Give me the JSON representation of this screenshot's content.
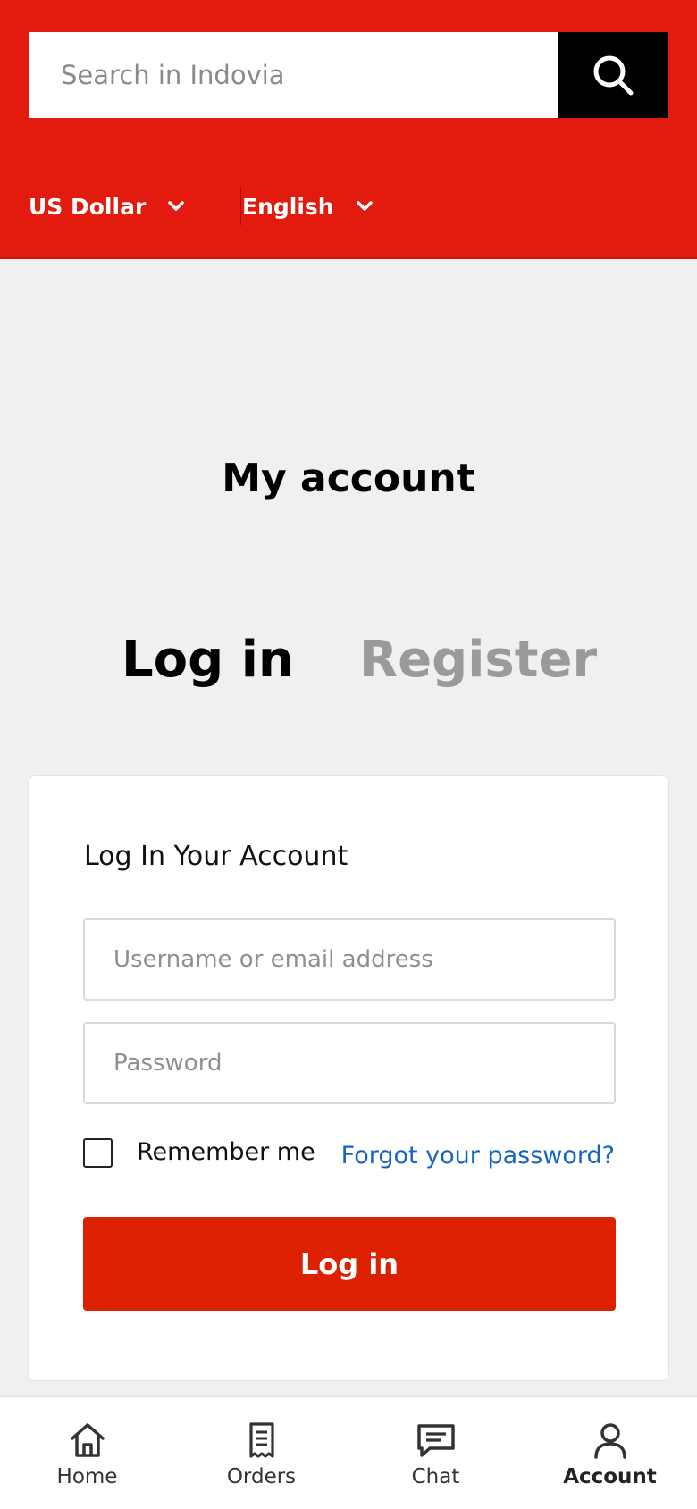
{
  "header": {
    "search_placeholder": "Search in Indovia",
    "search_icon": "search-icon"
  },
  "subbar": {
    "currency": "US Dollar",
    "language": "English"
  },
  "page": {
    "title": "My account",
    "tabs": [
      {
        "label": "Log in",
        "active": true
      },
      {
        "label": "Register",
        "active": false
      }
    ]
  },
  "login_form": {
    "heading": "Log In Your Account",
    "username_placeholder": "Username or email address",
    "password_placeholder": "Password",
    "remember_label": "Remember me",
    "forgot_link": "Forgot your password?",
    "submit_label": "Log in"
  },
  "bottom_nav": {
    "items": [
      {
        "label": "Home",
        "icon": "home-icon"
      },
      {
        "label": "Orders",
        "icon": "receipt-icon"
      },
      {
        "label": "Chat",
        "icon": "chat-icon"
      },
      {
        "label": "Account",
        "icon": "user-icon",
        "active": true
      }
    ]
  },
  "colors": {
    "brand_red": "#e21b0e",
    "button_red": "#dd2000",
    "link_blue": "#1565c0"
  }
}
